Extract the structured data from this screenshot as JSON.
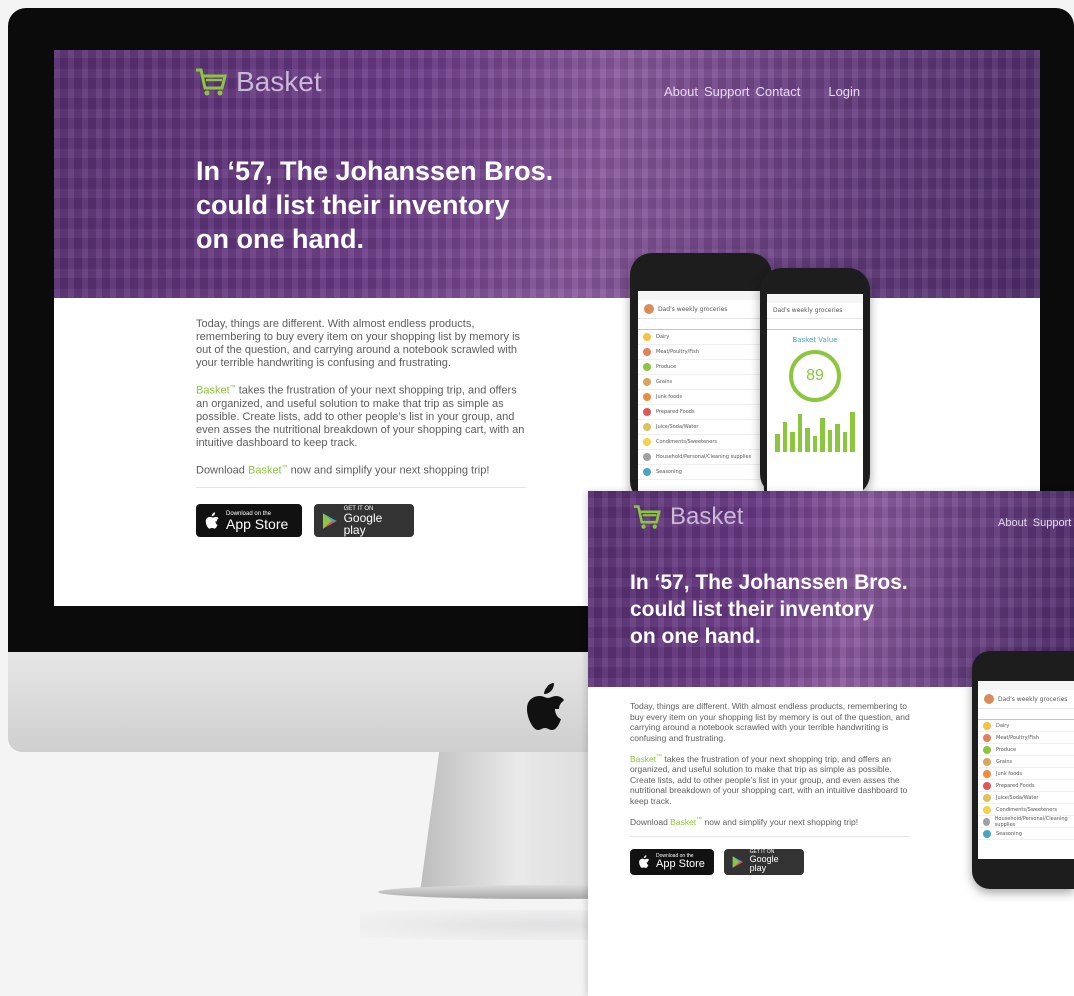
{
  "brand": {
    "name": "Basket",
    "accent": "#8cc63f",
    "hero_tint": "#6b3b87"
  },
  "nav": {
    "about": "About",
    "support": "Support",
    "contact": "Contact",
    "login": "Login"
  },
  "hero": {
    "line1": "In ‘57, The Johanssen Bros.",
    "line2": "could list their inventory",
    "line3": "on one hand."
  },
  "body": {
    "p1": "Today, things are different.  With almost endless products, remembering to buy every item on your shopping list by memory is out of the question, and carrying around a notebook scrawled with your terrible handwriting is confusing and frustrating.",
    "p2_brand": "Basket",
    "tm": "™",
    "p2_rest": " takes the frustration of your next shopping trip, and offers an organized, and useful solution to make that trip as simple as possible. Create lists, add to other people’s list in your group, and even asses the nutritional breakdown of your shopping cart, with an intuitive dashboard to keep track.",
    "p3_start": "Download ",
    "p3_brand": "Basket",
    "p3_end": " now and simplify your next shopping trip!"
  },
  "badges": {
    "appstore_small": "Download on the",
    "appstore_big": "App Store",
    "google_small": "GET IT ON",
    "google_big": "Google play"
  },
  "phone": {
    "list_title": "Dad's weekly groceries",
    "categories": [
      {
        "label": "Dairy",
        "color": "#f5c242"
      },
      {
        "label": "Meat/Poultry/Fish",
        "color": "#e67e5a"
      },
      {
        "label": "Produce",
        "color": "#8cc63f"
      },
      {
        "label": "Grains",
        "color": "#d9a55a"
      },
      {
        "label": "Junk foods",
        "color": "#f08a3c"
      },
      {
        "label": "Prepared Foods",
        "color": "#e05555"
      },
      {
        "label": "Juice/Soda/Water",
        "color": "#d9c35a"
      },
      {
        "label": "Condiments/Sweeteners",
        "color": "#f2d24a"
      },
      {
        "label": "Household/Personal/Cleaning supplies",
        "color": "#a0a0a0"
      },
      {
        "label": "Seasoning",
        "color": "#4aa3c9"
      }
    ],
    "score_title": "Basket Value",
    "score": "89",
    "bars": [
      0.45,
      0.75,
      0.5,
      0.95,
      0.6,
      0.4,
      0.85,
      0.55,
      0.7,
      0.5,
      1.0
    ]
  }
}
